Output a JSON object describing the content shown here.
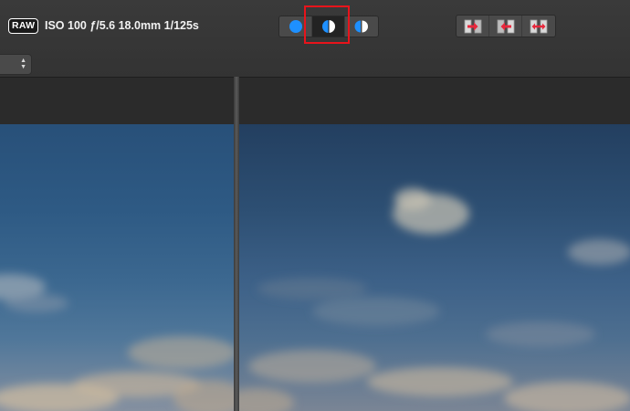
{
  "toolbar": {
    "raw_badge": "RAW",
    "exif": "ISO 100 ƒ/5.6 18.0mm 1/125s"
  },
  "view_modes": [
    {
      "name": "single-view",
      "icon": "circle-full-icon",
      "selected": false
    },
    {
      "name": "split-view",
      "icon": "circle-split-icon",
      "selected": true
    },
    {
      "name": "side-by-side-view",
      "icon": "circle-side-by-side-icon",
      "selected": false
    }
  ],
  "arrange_buttons": [
    {
      "name": "copy-right",
      "icon": "arrow-right-icon"
    },
    {
      "name": "copy-left",
      "icon": "arrow-left-icon"
    },
    {
      "name": "swap",
      "icon": "swap-arrows-icon"
    }
  ],
  "colors": {
    "accent_blue": "#1e90ff",
    "highlight_red": "#e8141b",
    "arrow_red": "#e8283c"
  }
}
